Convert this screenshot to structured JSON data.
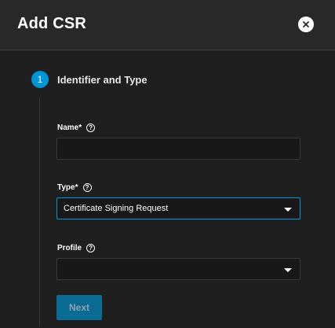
{
  "dialog": {
    "title": "Add CSR",
    "close_icon": "close-circle-icon"
  },
  "stepper": {
    "step_number": "1",
    "step_title": "Identifier and Type"
  },
  "form": {
    "name": {
      "label": "Name",
      "required_mark": "*",
      "value": "",
      "help_icon": "question-circle-icon"
    },
    "type": {
      "label": "Type",
      "required_mark": "*",
      "selected": "Certificate Signing Request",
      "help_icon": "question-circle-icon"
    },
    "profile": {
      "label": "Profile",
      "selected": "",
      "help_icon": "question-circle-icon"
    }
  },
  "actions": {
    "next_label": "Next"
  },
  "colors": {
    "accent": "#0095d5",
    "background": "#282828",
    "panel": "#1f1f1f"
  }
}
